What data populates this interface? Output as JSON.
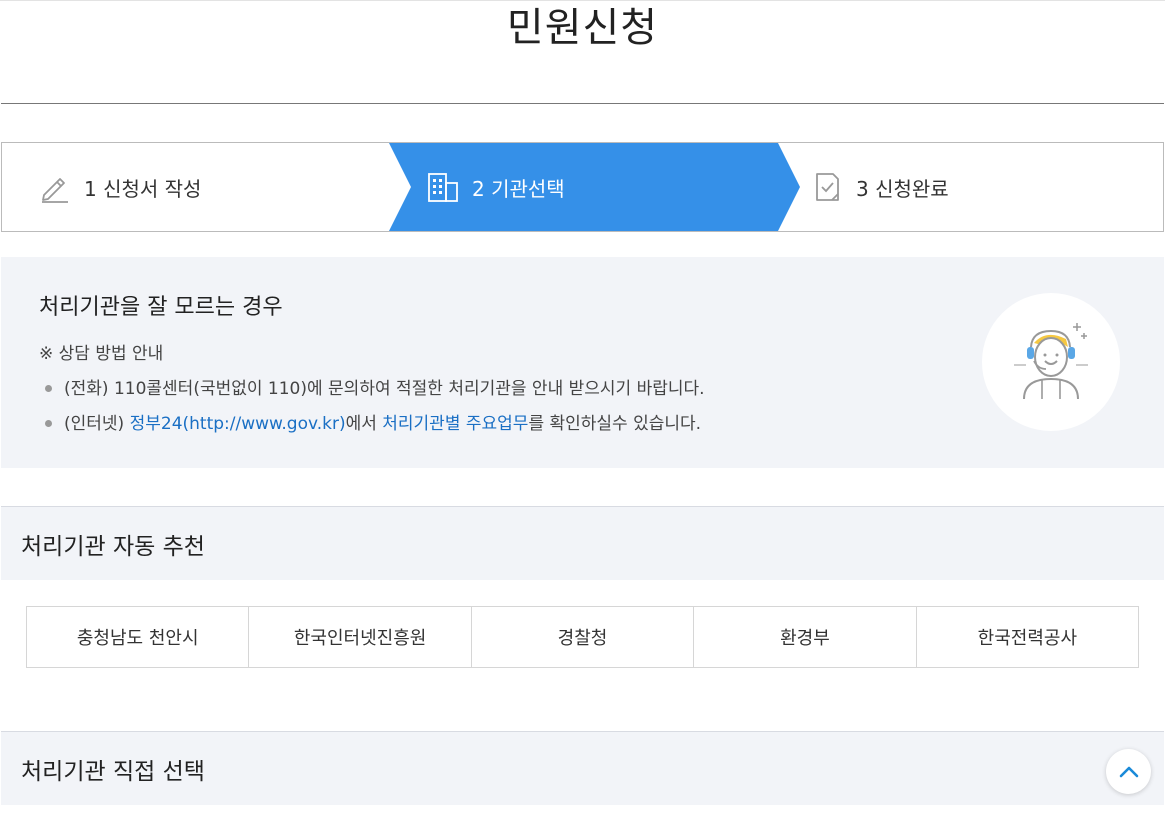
{
  "page": {
    "title": "민원신청"
  },
  "steps": [
    {
      "label": "1 신청서 작성",
      "icon": "pencil-icon",
      "active": false
    },
    {
      "label": "2 기관선택",
      "icon": "building-icon",
      "active": true
    },
    {
      "label": "3 신청완료",
      "icon": "document-check-icon",
      "active": false
    }
  ],
  "guide": {
    "title": "처리기관을 잘 모르는 경우",
    "note": "※ 상담 방법 안내",
    "phone_text": "(전화) 110콜센터(국번없이 110)에 문의하여 적절한 처리기관을 안내 받으시기 바랍니다.",
    "internet_prefix": "(인터넷) ",
    "internet_link1": "정부24(http://www.gov.kr)",
    "internet_mid": "에서 ",
    "internet_link2": "처리기관별 주요업무",
    "internet_suffix": "를 확인하실수 있습니다.",
    "avatar_icon": "consultant-headset-icon"
  },
  "auto_section": {
    "title": "처리기관 자동 추천",
    "agencies": [
      "충청남도 천안시",
      "한국인터넷진흥원",
      "경찰청",
      "환경부",
      "한국전력공사"
    ]
  },
  "direct_section": {
    "title": "처리기관 직접 선택"
  },
  "colors": {
    "accent": "#3590e8",
    "link": "#1a6fc4",
    "panel_bg": "#f2f4f8"
  }
}
